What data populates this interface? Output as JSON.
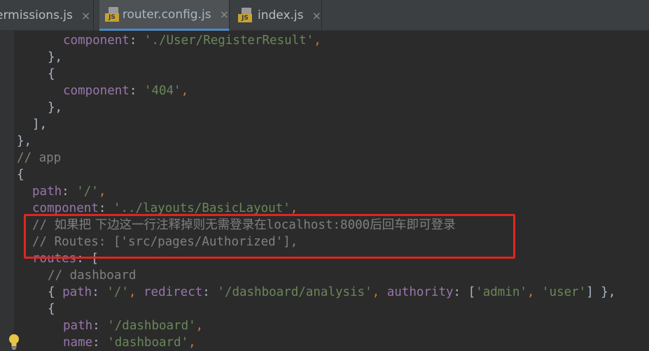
{
  "tabs": [
    {
      "label": "ermissions.js",
      "close": "×"
    },
    {
      "label": "router.config.js",
      "close": "×",
      "active": true,
      "icon_badge": "JS"
    },
    {
      "label": "index.js",
      "close": "×",
      "icon_badge": "JS"
    }
  ],
  "code": {
    "l1": {
      "prop": "component",
      "colon": ": ",
      "str": "'./User/RegisterResult'",
      "tail": ","
    },
    "l2": "},",
    "l3": "{",
    "l4": {
      "prop": "component",
      "colon": ": ",
      "str": "'404'",
      "tail": ","
    },
    "l5": "},",
    "l6": "],",
    "l7": "},",
    "l8": "// app",
    "l9": "{",
    "l10": {
      "prop": "path",
      "colon": ": ",
      "str": "'/'",
      "tail": ","
    },
    "l11": {
      "prop": "component",
      "colon": ": ",
      "str": "'../layouts/BasicLayout'",
      "tail": ","
    },
    "l12": {
      "prefix": "// ",
      "cn1": "如果把 下边这一行注释掉则无需登录在",
      "mono": "localhost:8000",
      "cn2": "后回车即可登录"
    },
    "l13": "// Routes: ['src/pages/Authorized'],",
    "l14": {
      "prop": "routes",
      "colon": ": ",
      "tail": "["
    },
    "l15": "// dashboard",
    "l16": {
      "open": "{ ",
      "p1": "path",
      "c1": ": ",
      "s1": "'/'",
      "sep1": ", ",
      "p2": "redirect",
      "c2": ": ",
      "s2": "'/dashboard/analysis'",
      "sep2": ", ",
      "p3": "authority",
      "c3": ": [",
      "s3": "'admin'",
      "sep3": ", ",
      "s4": "'user'",
      "close": "] },"
    },
    "l17": "{",
    "l18": {
      "prop": "path",
      "colon": ": ",
      "str": "'/dashboard'",
      "tail": ","
    },
    "l19": {
      "prop": "name",
      "colon": ": ",
      "str": "'dashboard'",
      "tail": ","
    }
  },
  "colors": {
    "keyword": "#cc7832",
    "string": "#6a8759",
    "property": "#9876aa",
    "comment": "#808080",
    "highlight": "#e0261f"
  }
}
